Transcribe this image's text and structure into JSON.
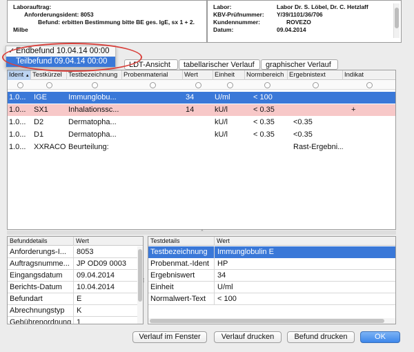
{
  "info_left": {
    "lines": [
      "Laborauftrag:",
      "Anforderungsident: 8053",
      "Befund: erbitten Bestimmung bitte BE ges. IgE, sx 1 + 2.",
      "Milbe"
    ]
  },
  "info_right": {
    "rows": [
      {
        "k": "Labor:",
        "v": "Labor Dr. S. Löbel, Dr. C. Hetzlaff"
      },
      {
        "k": "KBV-Prüfnummer:",
        "v": "Y/39/1101/36/706"
      },
      {
        "k": "Kundennummer:",
        "v": "ROVEZO"
      },
      {
        "k": "Datum:",
        "v": "09.04.2014"
      }
    ]
  },
  "menu": {
    "items": [
      {
        "label": "Endbefund 10.04.14 00:00",
        "check": "✓"
      },
      {
        "label": "Teilbefund 09.04.14 00:00",
        "check": ""
      }
    ]
  },
  "tabs": [
    "LDT-Ansicht",
    "tabellarischer Verlauf",
    "graphischer Verlauf"
  ],
  "main_table": {
    "columns": [
      "Ident",
      "Testkürzel",
      "Testbezeichnung",
      "Probenmaterial",
      "Wert",
      "Einheit",
      "Normbereich",
      "Ergebnistext",
      "Indikat"
    ],
    "sort_indicator": "▲",
    "rows": [
      [
        "1.0...",
        "IGE",
        "Immunglobu...",
        "",
        "34",
        "U/ml",
        "< 100",
        "",
        ""
      ],
      [
        "1.0...",
        "SX1",
        "Inhalationssc...",
        "",
        "14",
        "kU/l",
        "< 0.35",
        "",
        "+"
      ],
      [
        "1.0...",
        "D2",
        "Dermatopha...",
        "",
        "",
        "kU/l",
        "< 0.35",
        "<0.35",
        ""
      ],
      [
        "1.0...",
        "D1",
        "Dermatopha...",
        "",
        "",
        "kU/l",
        "< 0.35",
        "<0.35",
        ""
      ],
      [
        "1.0...",
        "XXRACO",
        "Beurteilung:",
        "",
        "",
        "",
        "",
        "Rast-Ergebni...",
        ""
      ]
    ]
  },
  "befunddetails": {
    "header_key": "Befunddetails",
    "header_val": "Wert",
    "rows": [
      {
        "k": "Anforderungs-I...",
        "v": "8053"
      },
      {
        "k": "Auftragsnumme...",
        "v": "JP OD09 0003"
      },
      {
        "k": "Eingangsdatum",
        "v": "09.04.2014"
      },
      {
        "k": "Berichts-Datum",
        "v": "10.04.2014"
      },
      {
        "k": "Befundart",
        "v": "E"
      },
      {
        "k": "Abrechnungstyp",
        "v": "K"
      },
      {
        "k": "Gebührenordnung",
        "v": "1"
      }
    ]
  },
  "testdetails": {
    "header_key": "Testdetails",
    "header_val": "Wert",
    "rows": [
      {
        "k": "Testbezeichnung",
        "v": "Immunglobulin E"
      },
      {
        "k": "Probenmat.-Ident",
        "v": "HP"
      },
      {
        "k": "Ergebniswert",
        "v": "34"
      },
      {
        "k": "Einheit",
        "v": "U/ml"
      },
      {
        "k": "Normalwert-Text",
        "v": "< 100"
      }
    ]
  },
  "buttons": {
    "verlauf_fenster": "Verlauf im Fenster",
    "verlauf_drucken": "Verlauf drucken",
    "befund_drucken": "Befund drucken",
    "ok": "OK"
  },
  "colors": {
    "selection": "#3a78d8",
    "warning_row": "#f7c8c8",
    "annotation": "#d9413c"
  }
}
